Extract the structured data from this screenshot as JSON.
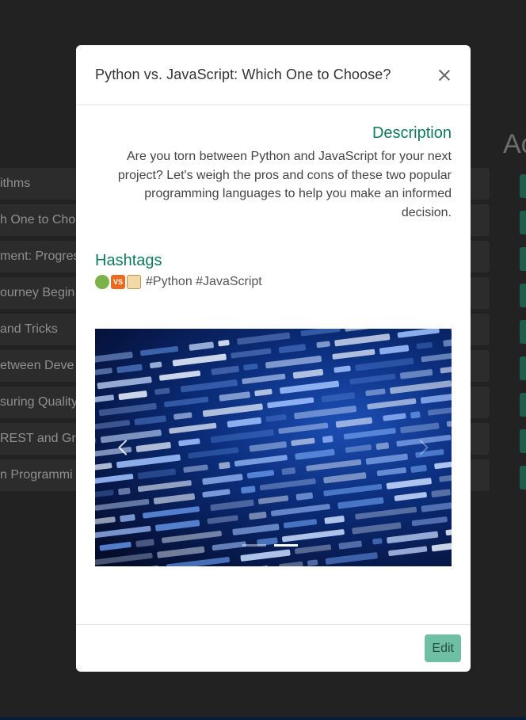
{
  "background": {
    "heading": "Ac",
    "list_items": [
      "ithms",
      "h One to Cho",
      "ment: Progres",
      "ourney Begin",
      "and Tricks",
      "etween Deve",
      "suring Quality",
      "REST and Gra",
      "n Programmi"
    ]
  },
  "modal": {
    "title": "Python vs. JavaScript: Which One to Choose?",
    "description_title": "Description",
    "description_text": "Are you torn between Python and JavaScript for your next project? Let's weigh the pros and cons of these two popular programming languages to help you make an informed decision.",
    "hashtags_title": "Hashtags",
    "hashtags_text": "#Python #JavaScript",
    "emojis": [
      "snake-emoji",
      "vs-emoji",
      "scroll-emoji"
    ],
    "vs_label": "VS",
    "carousel": {
      "image": "code-screen-image",
      "slides": 2,
      "active_slide": 2
    },
    "edit_label": "Edit"
  },
  "colors": {
    "accent": "#0f7a5a",
    "edit_button": "#6fbfa4",
    "backdrop": "#222222"
  }
}
